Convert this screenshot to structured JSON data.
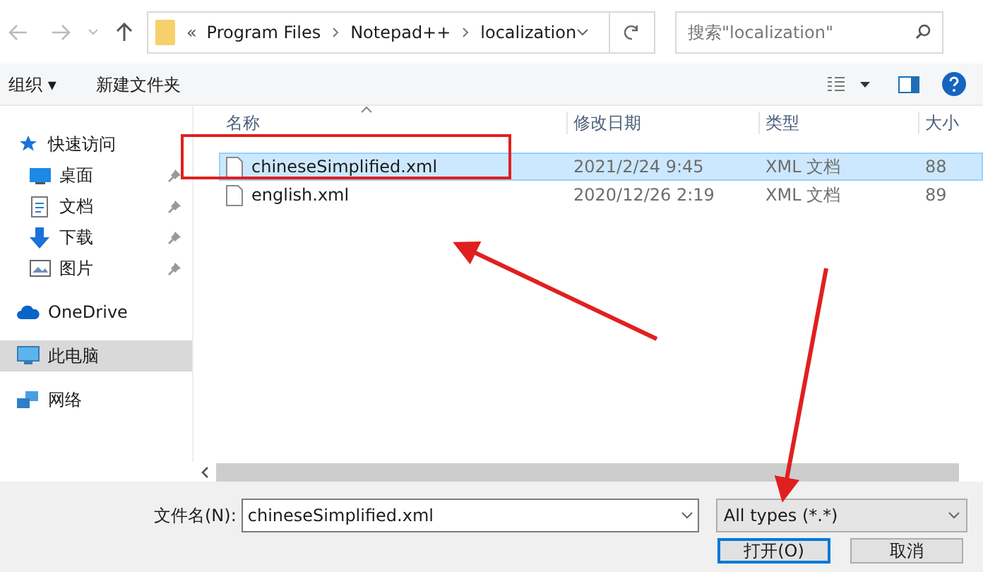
{
  "address_bar": {
    "overflow": "«",
    "segments": [
      "Program Files",
      "Notepad++",
      "localization"
    ]
  },
  "search": {
    "placeholder": "搜索\"localization\""
  },
  "toolbar": {
    "organize": "组织 ▾",
    "new_folder": "新建文件夹"
  },
  "sidebar": {
    "items": [
      {
        "label": "快速访问",
        "selected": false,
        "children": [
          {
            "label": "桌面",
            "pinned": true,
            "selected": false
          },
          {
            "label": "文档",
            "pinned": true,
            "selected": false
          },
          {
            "label": "下载",
            "pinned": true,
            "selected": false
          },
          {
            "label": "图片",
            "pinned": true,
            "selected": false
          }
        ]
      },
      {
        "label": "OneDrive",
        "selected": false
      },
      {
        "label": "此电脑",
        "selected": true
      },
      {
        "label": "网络",
        "selected": false
      }
    ]
  },
  "table": {
    "columns": [
      "名称",
      "修改日期",
      "类型",
      "大小"
    ],
    "rows": [
      {
        "name": "chineseSimplified.xml",
        "modified": "2021/2/24 9:45",
        "type": "XML 文档",
        "size": "88",
        "selected": true
      },
      {
        "name": "english.xml",
        "modified": "2020/12/26 2:19",
        "type": "XML 文档",
        "size": "89",
        "selected": false
      }
    ]
  },
  "footer": {
    "filename_label": "文件名(N):",
    "filename_value": "chineseSimplified.xml",
    "filter": "All types (*.*)",
    "open": "打开(O)",
    "cancel": "取消"
  }
}
